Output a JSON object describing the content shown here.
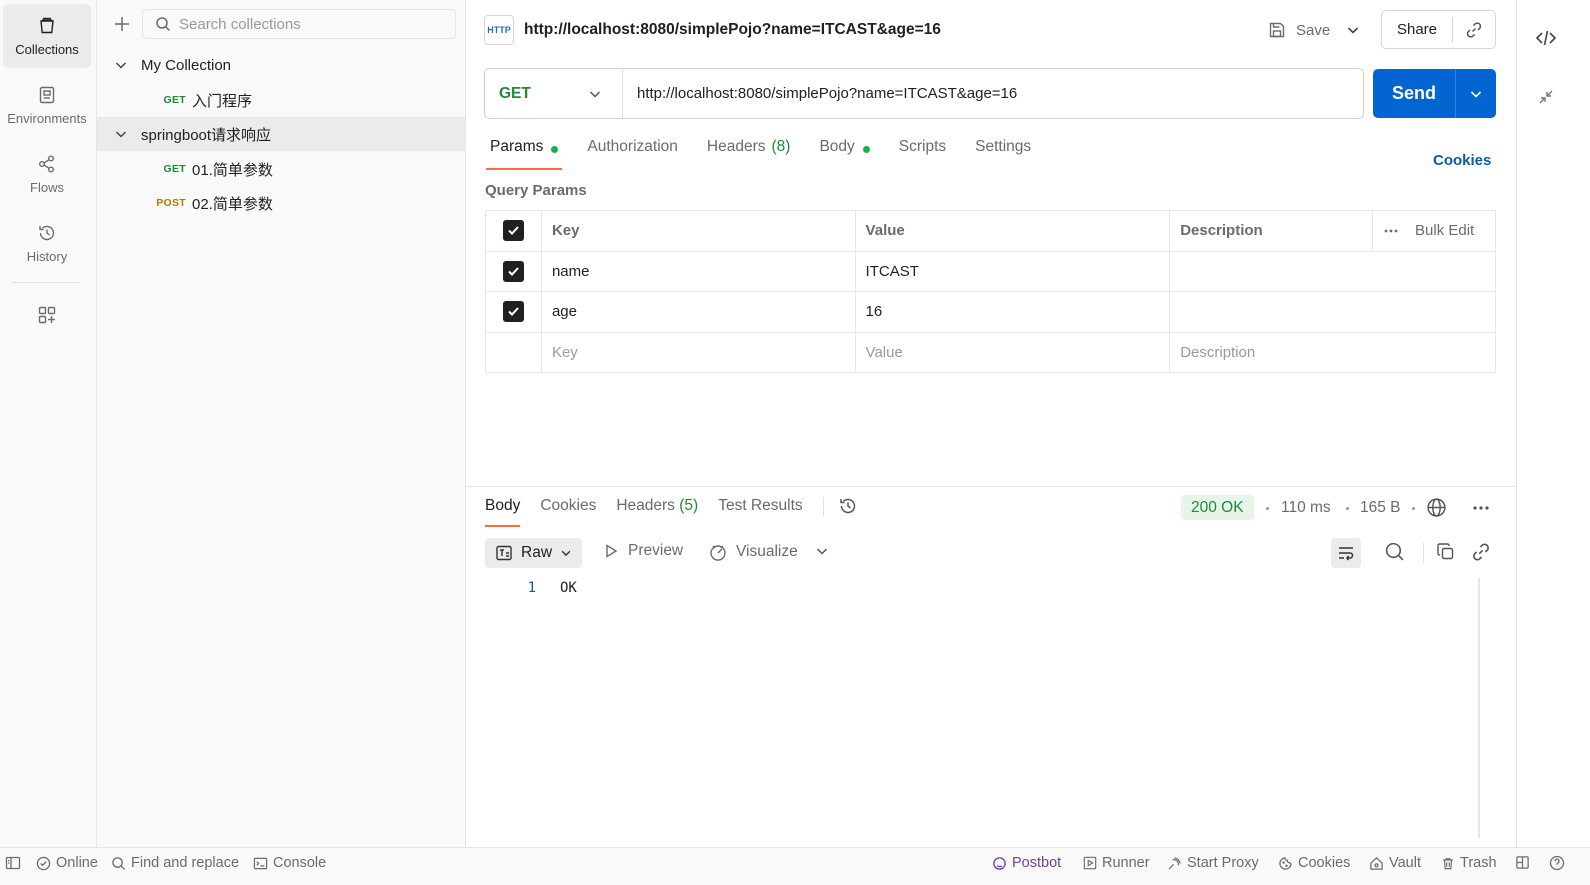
{
  "rail": {
    "items": [
      {
        "label": "Collections",
        "icon": "collections-icon"
      },
      {
        "label": "Environments",
        "icon": "environments-icon"
      },
      {
        "label": "Flows",
        "icon": "flows-icon"
      },
      {
        "label": "History",
        "icon": "history-icon"
      }
    ]
  },
  "sidebar": {
    "search_placeholder": "Search collections",
    "tree": [
      {
        "label": "My Collection"
      },
      {
        "method": "GET",
        "label": "入门程序"
      },
      {
        "label": "springboot请求响应"
      },
      {
        "method": "GET",
        "label": "01.简单参数"
      },
      {
        "method": "POST",
        "label": "02.简单参数"
      }
    ]
  },
  "request": {
    "badge": "HTTP",
    "title": "http://localhost:8080/simplePojo?name=ITCAST&age=16",
    "save_label": "Save",
    "share_label": "Share",
    "method": "GET",
    "url": "http://localhost:8080/simplePojo?name=ITCAST&age=16",
    "send_label": "Send",
    "tabs": {
      "params": "Params",
      "authorization": "Authorization",
      "headers": "Headers",
      "headers_count": "(8)",
      "body": "Body",
      "scripts": "Scripts",
      "settings": "Settings"
    },
    "cookies_label": "Cookies"
  },
  "query_params": {
    "label": "Query Params",
    "headers": {
      "key": "Key",
      "value": "Value",
      "description": "Description",
      "bulk_edit": "Bulk Edit"
    },
    "rows": [
      {
        "key": "name",
        "value": "ITCAST",
        "description": ""
      },
      {
        "key": "age",
        "value": "16",
        "description": ""
      }
    ],
    "placeholders": {
      "key": "Key",
      "value": "Value",
      "description": "Description"
    }
  },
  "response": {
    "tabs": {
      "body": "Body",
      "cookies": "Cookies",
      "headers": "Headers",
      "headers_count": "(5)",
      "test_results": "Test Results"
    },
    "status": "200 OK",
    "time": "110 ms",
    "size": "165 B",
    "format": "Raw",
    "preview_label": "Preview",
    "visualize_label": "Visualize",
    "lines": [
      {
        "num": "1",
        "text": "OK"
      }
    ]
  },
  "statusbar": {
    "online": "Online",
    "find_replace": "Find and replace",
    "console": "Console",
    "postbot": "Postbot",
    "runner": "Runner",
    "start_proxy": "Start Proxy",
    "cookies": "Cookies",
    "vault": "Vault",
    "trash": "Trash"
  },
  "colors": {
    "accent": "#ff6c37",
    "send": "#0265d2",
    "get": "#1f8a3a",
    "post": "#ad7a03"
  }
}
